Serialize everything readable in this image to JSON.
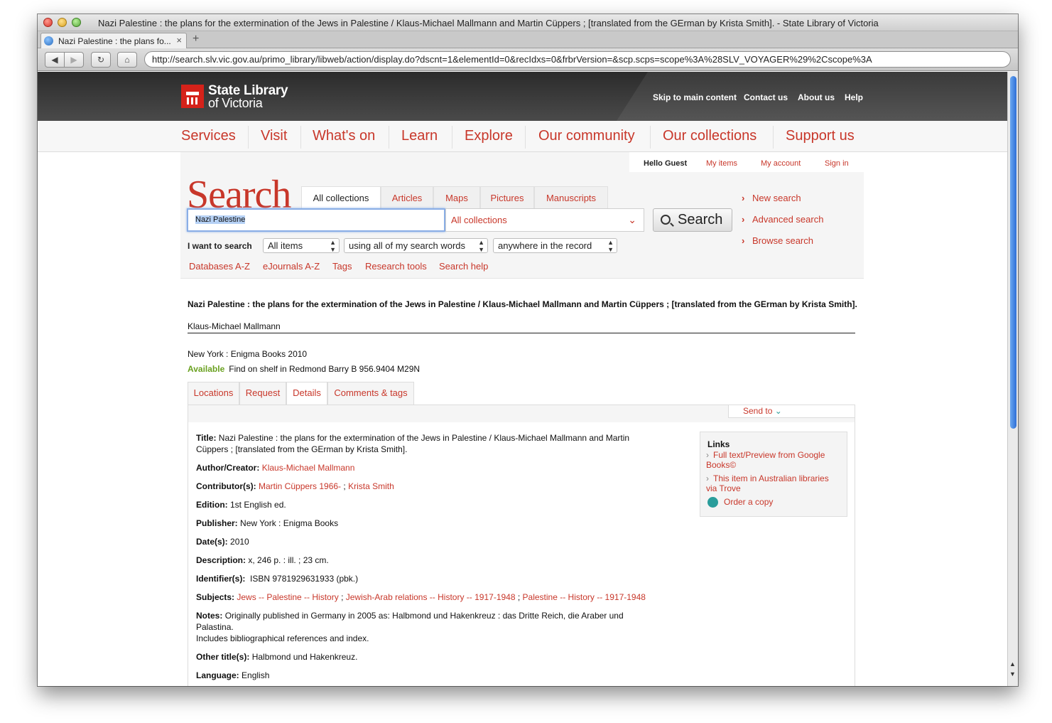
{
  "window": {
    "title": "Nazi Palestine : the plans for the extermination of the Jews in Palestine / Klaus-Michael Mallmann and Martin Cüppers ; [translated from the GErman by Krista Smith]. - State Library of Victoria",
    "tab_label": "Nazi Palestine : the plans fo...",
    "tab_close": "×",
    "new_tab": "+",
    "url": "http://search.slv.vic.gov.au/primo_library/libweb/action/display.do?dscnt=1&elementId=0&recIdxs=0&frbrVersion=&scp.scps=scope%3A%28SLV_VOYAGER%29%2Cscope%3A"
  },
  "toolbar": {
    "back": "◀",
    "forward": "▶",
    "reload": "↻",
    "home": "⌂"
  },
  "header": {
    "logo_line1": "State Library",
    "logo_line2": "of Victoria",
    "links": [
      "Skip to main content",
      "Contact us",
      "About us",
      "Help"
    ]
  },
  "mainnav": [
    "Services",
    "Visit",
    "What's on",
    "Learn",
    "Explore",
    "Our community",
    "Our collections",
    "Support us"
  ],
  "userbar": {
    "greeting": "Hello Guest",
    "links": [
      "My items",
      "My account",
      "Sign in"
    ]
  },
  "search": {
    "heading": "Search",
    "tabs": [
      "All collections",
      "Articles",
      "Maps",
      "Pictures",
      "Manuscripts"
    ],
    "query": "Nazi Palestine",
    "scope": "All collections",
    "button": "Search",
    "i_want": "I want to search",
    "selects": [
      "All items",
      "using all of my search words",
      "anywhere in the record"
    ],
    "quick_links": [
      "Databases A-Z",
      "eJournals A-Z",
      "Tags",
      "Research tools",
      "Search help"
    ],
    "right_links": [
      "New search",
      "Advanced search",
      "Browse search"
    ]
  },
  "record": {
    "title": "Nazi Palestine : the plans for the extermination of the Jews in Palestine / Klaus-Michael Mallmann and Martin Cüppers ; [translated from the GErman by Krista Smith].",
    "author": "Klaus-Michael Mallmann",
    "publication": "New York : Enigma Books 2010",
    "availability": "Available",
    "location": "Find on shelf in Redmond Barry  B 956.9404 M29N",
    "tabs": [
      "Locations",
      "Request",
      "Details",
      "Comments & tags"
    ],
    "send_to": "Send to",
    "details": {
      "title_label": "Title:",
      "title_value": "Nazi Palestine : the plans for the extermination of the Jews in Palestine / Klaus-Michael Mallmann and Martin Cüppers ; [translated from the GErman by Krista Smith].",
      "author_label": "Author/Creator:",
      "author_value": "Klaus-Michael Mallmann",
      "contributor_label": "Contributor(s):",
      "contributor_1": "Martin Cüppers 1966-",
      "contributor_sep": " ; ",
      "contributor_2": "Krista Smith",
      "edition_label": "Edition:",
      "edition_value": "1st English ed.",
      "publisher_label": "Publisher:",
      "publisher_value": "New York : Enigma Books",
      "dates_label": "Date(s):",
      "dates_value": "2010",
      "description_label": "Description:",
      "description_value": "x, 246 p. : ill. ; 23 cm.",
      "identifier_label": "Identifier(s):",
      "identifier_value": "ISBN 9781929631933 (pbk.)",
      "subjects_label": "Subjects:",
      "subject_1": "Jews -- Palestine -- History",
      "subject_2": "Jewish-Arab relations -- History -- 1917-1948",
      "subject_3": "Palestine -- History -- 1917-1948",
      "subject_sep": " ; ",
      "notes_label": "Notes:",
      "notes_value": "Originally published in Germany in 2005 as: Halbmond und Hakenkreuz : das Dritte Reich, die Araber und Palastina.",
      "notes_value_2": "Includes bibliographical references and index.",
      "other_title_label": "Other title(s):",
      "other_title_value": "Halbmond und Hakenkreuz.",
      "language_label": "Language:",
      "language_value": "English"
    },
    "links_box": {
      "heading": "Links",
      "items": [
        "Full text/Preview from Google Books©",
        "This item in Australian libraries via Trove"
      ],
      "order": "Order a copy"
    }
  }
}
